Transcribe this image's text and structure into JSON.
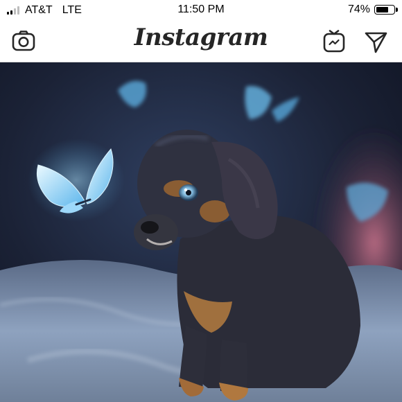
{
  "status_bar": {
    "carrier": "AT&T",
    "network": "LTE",
    "time": "11:50 PM",
    "battery_percent": "74%",
    "battery_level": 0.74,
    "signal_bars_active": 2,
    "signal_bars_total": 4
  },
  "header": {
    "title": "Instagram",
    "left_icon": "camera-icon",
    "right_icons": [
      "igtv-icon",
      "direct-message-icon"
    ]
  },
  "post": {
    "image": "puppy-with-butterfly-photo"
  },
  "colors": {
    "header_bg": "#ffffff",
    "icon": "#262626",
    "divider": "#dbdbdb"
  }
}
